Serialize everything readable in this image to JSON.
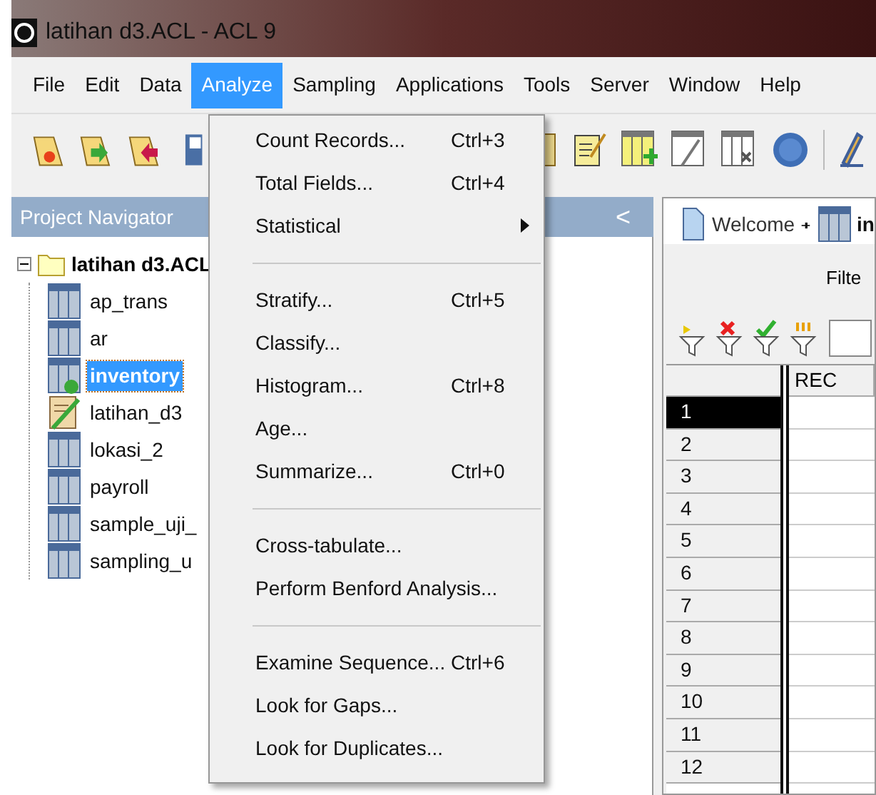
{
  "window": {
    "title": "latihan d3.ACL - ACL 9"
  },
  "menu_bar": [
    {
      "label": "File",
      "selected": false
    },
    {
      "label": "Edit",
      "selected": false
    },
    {
      "label": "Data",
      "selected": false
    },
    {
      "label": "Analyze",
      "selected": true
    },
    {
      "label": "Sampling",
      "selected": false
    },
    {
      "label": "Applications",
      "selected": false
    },
    {
      "label": "Tools",
      "selected": false
    },
    {
      "label": "Server",
      "selected": false
    },
    {
      "label": "Window",
      "selected": false
    },
    {
      "label": "Help",
      "selected": false
    }
  ],
  "project_navigator": {
    "title": "Project Navigator",
    "collapse_button": "<",
    "tree": [
      {
        "label": "latihan d3.ACL",
        "expanded": true,
        "children": [
          {
            "label": "ap_trans",
            "kind": "table",
            "selected": false
          },
          {
            "label": "ar",
            "kind": "table",
            "selected": false
          },
          {
            "label": "inventory",
            "kind": "open-table",
            "selected": true
          },
          {
            "label": "latihan_d3",
            "kind": "script",
            "selected": false
          },
          {
            "label": "lokasi_2",
            "kind": "table",
            "selected": false
          },
          {
            "label": "payroll",
            "kind": "table",
            "selected": false
          },
          {
            "label": "sample_uji_",
            "kind": "table",
            "selected": false
          },
          {
            "label": "sampling_u",
            "kind": "table",
            "selected": false
          }
        ]
      }
    ]
  },
  "tabs": [
    {
      "label": "Welcome",
      "kind": "page",
      "selected": false
    },
    {
      "label": "in",
      "kind": "table",
      "selected": true
    }
  ],
  "filter": {
    "label": "Filte"
  },
  "grid": {
    "columns": [
      "REC"
    ],
    "rows": [
      {
        "label": "1",
        "selected": true
      },
      {
        "label": "2",
        "selected": false
      },
      {
        "label": "3",
        "selected": false
      },
      {
        "label": "4",
        "selected": false
      },
      {
        "label": "5",
        "selected": false
      },
      {
        "label": "6",
        "selected": false
      },
      {
        "label": "7",
        "selected": false
      },
      {
        "label": "8",
        "selected": false
      },
      {
        "label": "9",
        "selected": false
      },
      {
        "label": "10",
        "selected": false
      },
      {
        "label": "11",
        "selected": false
      },
      {
        "label": "12",
        "selected": false
      }
    ]
  },
  "analyze_menu": [
    {
      "kind": "item",
      "label": "Count Records...",
      "shortcut": "Ctrl+3"
    },
    {
      "kind": "item",
      "label": "Total Fields...",
      "shortcut": "Ctrl+4"
    },
    {
      "kind": "submenu",
      "label": "Statistical"
    },
    {
      "kind": "separator"
    },
    {
      "kind": "item",
      "label": "Stratify...",
      "shortcut": "Ctrl+5"
    },
    {
      "kind": "item",
      "label": "Classify..."
    },
    {
      "kind": "item",
      "label": "Histogram...",
      "shortcut": "Ctrl+8"
    },
    {
      "kind": "item",
      "label": "Age..."
    },
    {
      "kind": "item",
      "label": "Summarize...",
      "shortcut": "Ctrl+0"
    },
    {
      "kind": "separator"
    },
    {
      "kind": "item",
      "label": "Cross-tabulate..."
    },
    {
      "kind": "item",
      "label": "Perform Benford Analysis..."
    },
    {
      "kind": "separator"
    },
    {
      "kind": "item",
      "label": "Examine Sequence...",
      "shortcut": "Ctrl+6"
    },
    {
      "kind": "item",
      "label": "Look for Gaps..."
    },
    {
      "kind": "item",
      "label": "Look for Duplicates..."
    }
  ]
}
